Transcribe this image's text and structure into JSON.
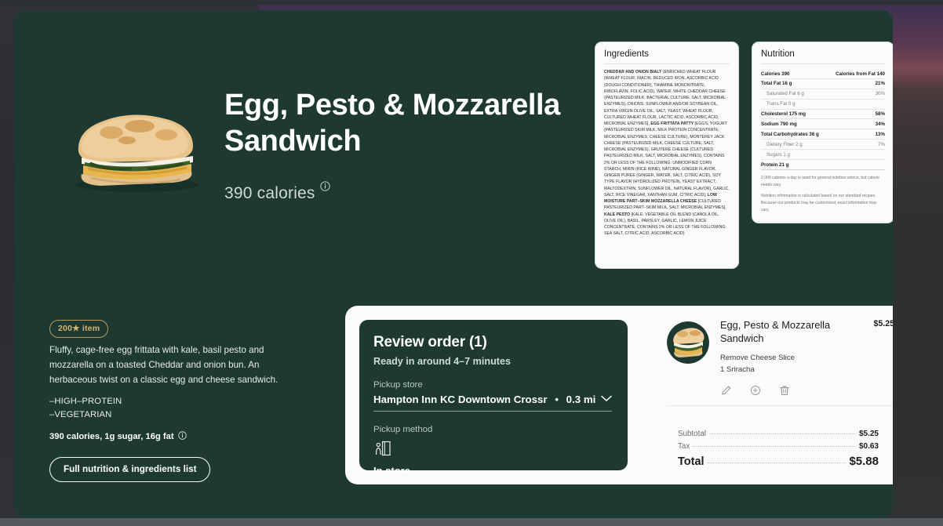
{
  "product": {
    "title": "Egg, Pesto & Mozzarella Sandwich",
    "calories": "390 calories",
    "badge": "200★ item",
    "description": "Fluffy, cage-free egg frittata with kale, basil pesto and mozzarella on a toasted Cheddar and onion bun. An herbaceous twist on a classic egg and cheese sandwich.",
    "tag_1": "–HIGH–PROTEIN",
    "tag_2": "–VEGETARIAN",
    "nutrition_summary": "390 calories, 1g sugar, 16g fat",
    "full_list_button": "Full nutrition & ingredients list"
  },
  "ingredients_card": {
    "heading": "Ingredients",
    "segments": [
      {
        "bold": true,
        "text": "CHEDDAR AND ONION BIALY "
      },
      {
        "bold": false,
        "text": "(ENRICHED WHEAT FLOUR (WHEAT FLOUR, NIACIN, REDUCED IRON, ASCORBIC ACID (DOUGH CONDITIONER), THIAMINE MONONITRATE, RIBOFLAVIN, FOLIC ACID), WATER, WHITE CHEDDAR CHEESE (PASTEURIZED MILK, BACTERIAL CULTURE, SALT, MICROBIAL ENZYMES), ONIONS, SUNFLOWER AND/OR SOYBEAN OIL, EXTRA VIRGIN OLIVE OIL, SALT, YEAST, WHEAT FLOUR, CULTURED WHEAT FLOUR, LACTIC ACID, ASCORBIC ACID, MICROBIAL ENZYMES], "
      },
      {
        "bold": true,
        "text": "EGG FRITTATA PATTY "
      },
      {
        "bold": false,
        "text": "[EGGS, YOGURT (PASTEURIZED SKIM MILK, MILK PROTEIN CONCENTRATE, MICROBIAL ENZYMES, CHEESE CULTURE), MONTEREY JACK CHEESE (PASTEURIZED MILK, CHEESE CULTURE, SALT, MICROBIAL ENZYMES), GRUYERE CHEESE (CULTURED PASTEURIZED MILK, SALT, MICROBIAL ENZYMES), CONTAINS 2% OR LESS OF THE FOLLOWING: UNMODIFIED CORN STARCH, MIRIN (RICE WINE), NATURAL GINGER FLAVOR, GINGER PUREE (GINGER, WATER, SALT, CITRIC ACID), SOY TYPE FLAVOR (HYDROLIZED PROTEIN, YEAST EXTRACT, MALTODEXTRIN, SUNFLOWER OIL, NATURAL FLAVOR), GARLIC, SALT, RICE VINEGAR, XANTHAN GUM, CITRIC ACID], "
      },
      {
        "bold": true,
        "text": "LOW MOISTURE PART–SKIM MOZZARELLA CHEESE "
      },
      {
        "bold": false,
        "text": "[CULTURED PASTEURIZED PART–SKIM MILK, SALT, MICROBIAL ENZYMES], "
      },
      {
        "bold": true,
        "text": "KALE PESTO "
      },
      {
        "bold": false,
        "text": "[KALE, VEGETABLE OIL BLEND (CANOLA OIL, OLIVE OIL), BASIL, PARSLEY, GARLIC, LEMON JUICE CONCENTRATE, CONTAINS 2% OR LESS OF THE FOLLOWING: SEA SALT, CITRIC ACID, ASCORBIC ACID)"
      }
    ]
  },
  "nutrition_card": {
    "heading": "Nutrition",
    "rows": [
      {
        "label": "Calories 390",
        "value": "Calories from Fat 140",
        "style": "bold-head"
      },
      {
        "label": "Total Fat  16 g",
        "value": "21%",
        "style": "bold"
      },
      {
        "label": "Saturated Fat  6 g",
        "value": "30%",
        "style": "sub"
      },
      {
        "label": "Trans Fat  0 g",
        "value": "",
        "style": "sub"
      },
      {
        "label": "Cholesterol  175 mg",
        "value": "58%",
        "style": "bold"
      },
      {
        "label": "Sodium  790 mg",
        "value": "34%",
        "style": "bold"
      },
      {
        "label": "Total Carbohydrates  36 g",
        "value": "13%",
        "style": "bold"
      },
      {
        "label": "Dietary Fiber  2 g",
        "value": "7%",
        "style": "sub"
      },
      {
        "label": "Sugars  1 g",
        "value": "",
        "style": "sub"
      },
      {
        "label": "Protein  21 g",
        "value": "",
        "style": "bold last"
      }
    ],
    "note_1": "2,000 calories a day is used for general nutrition advice, but calorie needs vary.",
    "note_2": "Nutrition information is calculated based on our standard recipes. Because our products may be customized, exact information may vary."
  },
  "review_order": {
    "heading": "Review order (1)",
    "ready": "Ready in around 4–7 minutes",
    "pickup_store_label": "Pickup store",
    "store_name": "Hampton Inn KC Downtown Crossr",
    "store_distance": "0.3 mi",
    "store_separator": "•",
    "pickup_method_label": "Pickup method",
    "pickup_method_value": "In store"
  },
  "cart_item": {
    "name": "Egg, Pesto & Mozzarella Sandwich",
    "price": "$5.25",
    "mod_1": "Remove Cheese Slice",
    "mod_2": "1 Sriracha"
  },
  "totals": {
    "subtotal_label": "Subtotal",
    "subtotal_value": "$5.25",
    "tax_label": "Tax",
    "tax_value": "$0.63",
    "total_label": "Total",
    "total_value": "$5.88"
  },
  "colors": {
    "brand_green": "#1e3932",
    "card_bg": "#fbfbf9",
    "gold": "#d5b673",
    "muted_text": "#cfdbd4"
  }
}
